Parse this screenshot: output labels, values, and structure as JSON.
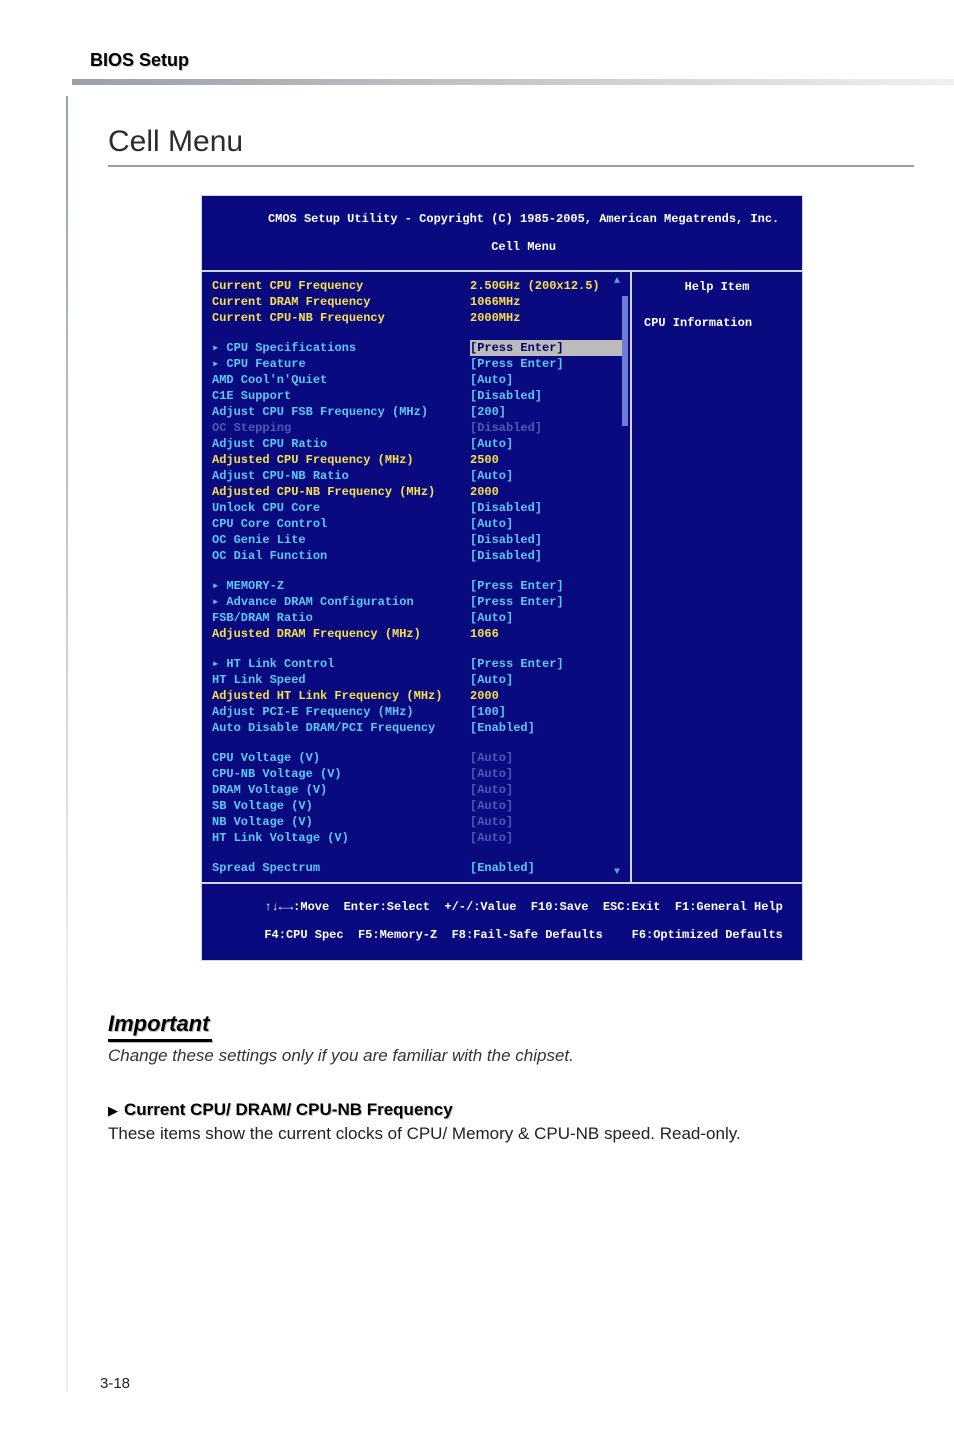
{
  "header": {
    "section": "BIOS Setup"
  },
  "page_title": "Cell Menu",
  "bios": {
    "title_line1": "CMOS Setup Utility - Copyright (C) 1985-2005, American Megatrends, Inc.",
    "title_line2": "Cell Menu",
    "help_header": "Help Item",
    "help_body": "CPU Information",
    "footer_line1": "↑↓←→:Move  Enter:Select  +/-/:Value  F10:Save  ESC:Exit  F1:General Help",
    "footer_line2": "F4:CPU Spec  F5:Memory-Z  F8:Fail-Safe Defaults    F6:Optimized Defaults",
    "groups": [
      [
        {
          "label": "Current CPU Frequency",
          "value": "2.50GHz (200x12.5)",
          "lcls": "yellow",
          "vcls": "yellow"
        },
        {
          "label": "Current DRAM Frequency",
          "value": "1066MHz",
          "lcls": "yellow",
          "vcls": "yellow"
        },
        {
          "label": "Current CPU-NB Frequency",
          "value": "2000MHz",
          "lcls": "yellow",
          "vcls": "yellow"
        }
      ],
      [
        {
          "label": "▸ CPU Specifications",
          "value": "[Press Enter]",
          "lcls": "cyan",
          "vcls": "hl"
        },
        {
          "label": "▸ CPU Feature",
          "value": "[Press Enter]",
          "lcls": "cyan",
          "vcls": "cyan"
        },
        {
          "label": "AMD Cool'n'Quiet",
          "value": "[Auto]",
          "lcls": "cyan",
          "vcls": "cyan"
        },
        {
          "label": "C1E Support",
          "value": "[Disabled]",
          "lcls": "cyan",
          "vcls": "cyan"
        },
        {
          "label": "Adjust CPU FSB Frequency (MHz)",
          "value": "[200]",
          "lcls": "cyan",
          "vcls": "cyan"
        },
        {
          "label": "OC Stepping",
          "value": "[Disabled]",
          "lcls": "dim",
          "vcls": "dim"
        },
        {
          "label": "Adjust CPU Ratio",
          "value": "[Auto]",
          "lcls": "cyan",
          "vcls": "cyan"
        },
        {
          "label": "Adjusted CPU Frequency (MHz)",
          "value": "2500",
          "lcls": "yellow",
          "vcls": "yellow"
        },
        {
          "label": "Adjust CPU-NB Ratio",
          "value": "[Auto]",
          "lcls": "cyan",
          "vcls": "cyan"
        },
        {
          "label": "Adjusted CPU-NB Frequency (MHz)",
          "value": "2000",
          "lcls": "yellow",
          "vcls": "yellow"
        },
        {
          "label": "Unlock CPU Core",
          "value": "[Disabled]",
          "lcls": "cyan",
          "vcls": "cyan"
        },
        {
          "label": "CPU Core Control",
          "value": "[Auto]",
          "lcls": "cyan",
          "vcls": "cyan"
        },
        {
          "label": "OC Genie Lite",
          "value": "[Disabled]",
          "lcls": "cyan",
          "vcls": "cyan"
        },
        {
          "label": "OC Dial Function",
          "value": "[Disabled]",
          "lcls": "cyan",
          "vcls": "cyan"
        }
      ],
      [
        {
          "label": "▸ MEMORY-Z",
          "value": "[Press Enter]",
          "lcls": "cyan",
          "vcls": "cyan"
        },
        {
          "label": "▸ Advance DRAM Configuration",
          "value": "[Press Enter]",
          "lcls": "cyan",
          "vcls": "cyan"
        },
        {
          "label": "FSB/DRAM Ratio",
          "value": "[Auto]",
          "lcls": "cyan",
          "vcls": "cyan"
        },
        {
          "label": "Adjusted DRAM Frequency (MHz)",
          "value": "1066",
          "lcls": "yellow",
          "vcls": "yellow"
        }
      ],
      [
        {
          "label": "▸ HT Link Control",
          "value": "[Press Enter]",
          "lcls": "cyan",
          "vcls": "cyan"
        },
        {
          "label": "HT Link Speed",
          "value": "[Auto]",
          "lcls": "cyan",
          "vcls": "cyan"
        },
        {
          "label": "Adjusted HT Link Frequency (MHz)",
          "value": "2000",
          "lcls": "yellow",
          "vcls": "yellow"
        },
        {
          "label": "Adjust PCI-E Frequency (MHz)",
          "value": "[100]",
          "lcls": "cyan",
          "vcls": "cyan"
        },
        {
          "label": "Auto Disable DRAM/PCI Frequency",
          "value": "[Enabled]",
          "lcls": "cyan",
          "vcls": "cyan"
        }
      ],
      [
        {
          "label": "CPU Voltage (V)",
          "value": "[Auto]",
          "lcls": "cyan",
          "vcls": "dim"
        },
        {
          "label": "CPU-NB Voltage (V)",
          "value": "[Auto]",
          "lcls": "cyan",
          "vcls": "dim"
        },
        {
          "label": "DRAM Voltage (V)",
          "value": "[Auto]",
          "lcls": "cyan",
          "vcls": "dim"
        },
        {
          "label": "SB Voltage (V)",
          "value": "[Auto]",
          "lcls": "cyan",
          "vcls": "dim"
        },
        {
          "label": "NB Voltage (V)",
          "value": "[Auto]",
          "lcls": "cyan",
          "vcls": "dim"
        },
        {
          "label": "HT Link Voltage (V)",
          "value": "[Auto]",
          "lcls": "cyan",
          "vcls": "dim"
        }
      ],
      [
        {
          "label": "Spread Spectrum",
          "value": "[Enabled]",
          "lcls": "cyan",
          "vcls": "cyan"
        }
      ]
    ]
  },
  "important": {
    "label": "Important",
    "text": "Change these settings only if you are familiar with the chipset."
  },
  "item": {
    "arrow": "▶",
    "title": "Current CPU/ DRAM/ CPU-NB Frequency",
    "body": "These items show the current clocks of CPU/ Memory & CPU-NB speed. Read-only."
  },
  "page_number": "3-18"
}
